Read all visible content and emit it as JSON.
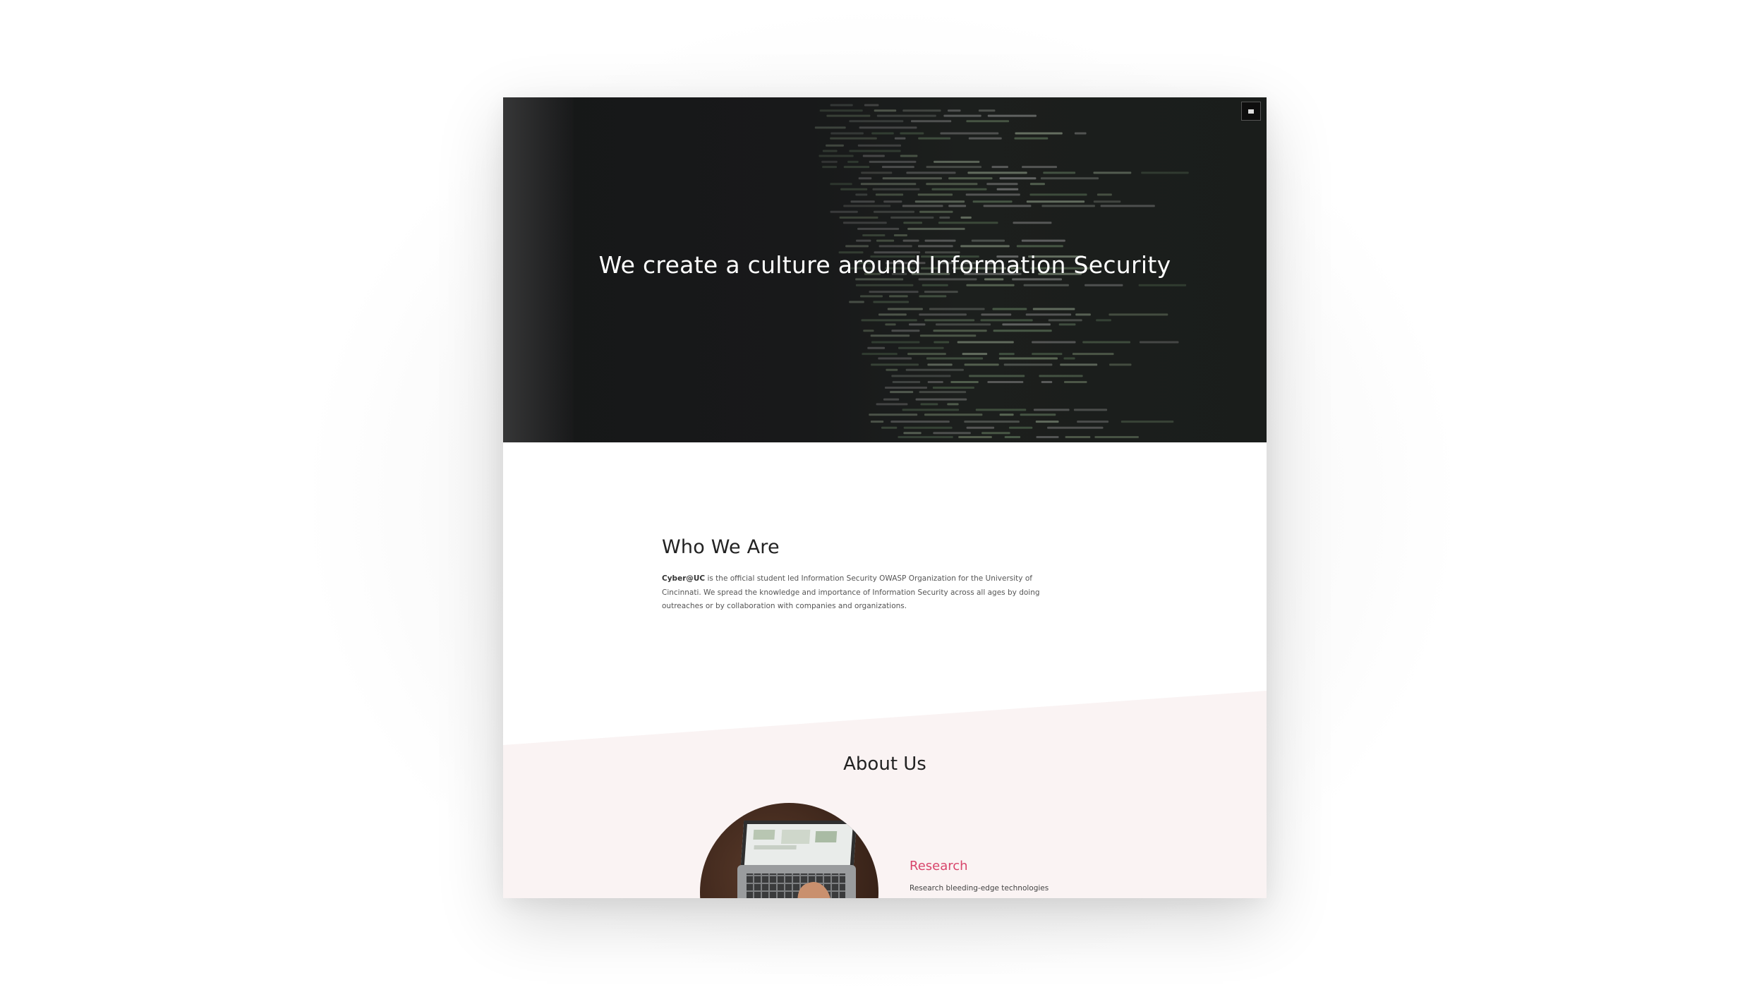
{
  "hero": {
    "title": "We create a culture around Information Security",
    "menu_icon": "hamburger-menu-icon"
  },
  "who_we_are": {
    "heading": "Who We Are",
    "org_name": "Cyber@UC",
    "description": " is the official student led Information Security OWASP Organization for the University of Cincinnati. We spread the knowledge and importance of Information Security across all ages by doing outreaches or by collaboration with companies and organizations."
  },
  "about_us": {
    "heading": "About Us",
    "items": [
      {
        "title": "Research",
        "text": "Research bleeding-edge technologies",
        "image": "laptop-photo"
      }
    ]
  },
  "colors": {
    "hero_background": "#18191a",
    "pink_band": "#faf3f3",
    "accent": "#d8456b",
    "heading_text": "#222222",
    "body_text": "#555555"
  }
}
